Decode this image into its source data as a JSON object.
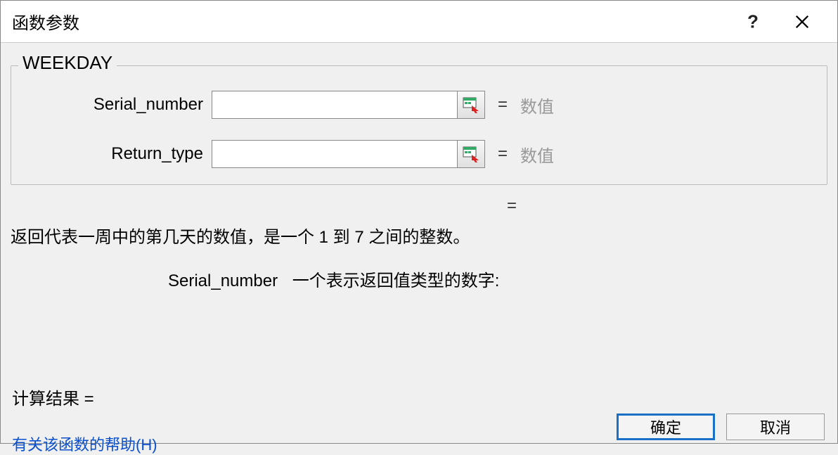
{
  "dialog": {
    "title": "函数参数",
    "help_glyph": "?",
    "function_group_legend": "WEEKDAY",
    "params": [
      {
        "label": "Serial_number",
        "value": "",
        "equals": "=",
        "hint": "数值"
      },
      {
        "label": "Return_type",
        "value": "",
        "equals": "=",
        "hint": "数值"
      }
    ],
    "mid_equals": "=",
    "description": "返回代表一周中的第几天的数值，是一个 1 到 7 之间的整数。",
    "current_param_label": "Serial_number",
    "current_param_help": "一个表示返回值类型的数字:",
    "calc_result_label": "计算结果 =",
    "help_link": "有关该函数的帮助(H)",
    "ok_label": "确定",
    "cancel_label": "取消"
  }
}
